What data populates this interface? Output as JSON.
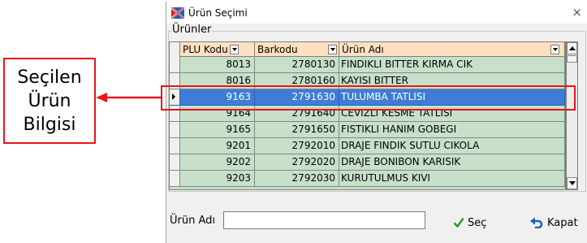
{
  "annotation": {
    "lines": [
      "Seçilen",
      "Ürün",
      "Bilgisi"
    ],
    "color": "#e8151b"
  },
  "window": {
    "title": "Ürün Seçimi",
    "close_glyph": "×",
    "app_icon": "flag-app-icon"
  },
  "group": {
    "label": "Ürünler"
  },
  "grid": {
    "columns": [
      {
        "label": "PLU Kodu"
      },
      {
        "label": "Barkodu"
      },
      {
        "label": "Ürün Adı"
      }
    ],
    "rows": [
      {
        "plu": "8013",
        "barkod": "2780130",
        "ad": "FINDIKLI BITTER KIRMA CIK"
      },
      {
        "plu": "8016",
        "barkod": "2780160",
        "ad": "KAYISI BITTER"
      },
      {
        "plu": "9163",
        "barkod": "2791630",
        "ad": "TULUMBA TATLISI",
        "selected": true
      },
      {
        "plu": "9164",
        "barkod": "2791640",
        "ad": "CEVIZLI KESME TATLISI"
      },
      {
        "plu": "9165",
        "barkod": "2791650",
        "ad": "FISTIKLI HANIM GOBEGI"
      },
      {
        "plu": "9201",
        "barkod": "2792010",
        "ad": "DRAJE FINDIK SUTLU CIKOLA"
      },
      {
        "plu": "9202",
        "barkod": "2792020",
        "ad": "DRAJE BONIBON KARISIK"
      },
      {
        "plu": "9203",
        "barkod": "2792030",
        "ad": "KURUTULMUS KIVI"
      }
    ],
    "colors": {
      "row_bg": "#c8e0cb",
      "header_bg": "#ffe0c0",
      "selected_bg": "#3d7dd8"
    }
  },
  "search": {
    "label": "Ürün Adı",
    "value": ""
  },
  "buttons": {
    "sec": {
      "label": "Seç",
      "icon": "checkmark-icon"
    },
    "kapat": {
      "label": "Kapat",
      "icon": "undo-arrow-icon"
    }
  }
}
